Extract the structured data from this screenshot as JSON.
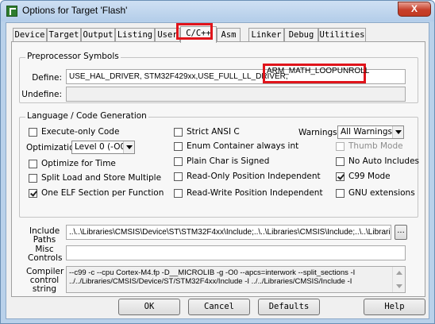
{
  "window": {
    "title": "Options for Target 'Flash'",
    "close_glyph": "X"
  },
  "tabs": [
    {
      "label": "Device"
    },
    {
      "label": "Target"
    },
    {
      "label": "Output"
    },
    {
      "label": "Listing"
    },
    {
      "label": "User"
    },
    {
      "label": "C/C++",
      "active": true
    },
    {
      "label": "Asm"
    },
    {
      "label": "Linker"
    },
    {
      "label": "Debug"
    },
    {
      "label": "Utilities"
    }
  ],
  "preprocessor": {
    "group_label": "Preprocessor Symbols",
    "define_label": "Define:",
    "define_value": "USE_HAL_DRIVER, STM32F429xx,USE_FULL_LL_DRIVER,",
    "define_highlighted": "ARM_MATH_LOOPUNROLL",
    "undefine_label": "Undefine:",
    "undefine_value": ""
  },
  "language": {
    "group_label": "Language / Code Generation",
    "optimization_label": "Optimization:",
    "optimization_value": "Level 0 (-O0)",
    "warnings_label": "Warnings:",
    "warnings_value": "All Warnings",
    "checks": {
      "execute_only": {
        "label": "Execute-only Code",
        "checked": false
      },
      "optimize_time": {
        "label": "Optimize for Time",
        "checked": false
      },
      "split_load": {
        "label": "Split Load and Store Multiple",
        "checked": false
      },
      "one_elf": {
        "label": "One ELF Section per Function",
        "checked": true
      },
      "strict_ansi": {
        "label": "Strict ANSI C",
        "checked": false
      },
      "enum_container": {
        "label": "Enum Container always int",
        "checked": false
      },
      "plain_char": {
        "label": "Plain Char is Signed",
        "checked": false
      },
      "ro_pos": {
        "label": "Read-Only Position Independent",
        "checked": false
      },
      "rw_pos": {
        "label": "Read-Write Position Independent",
        "checked": false
      },
      "thumb_mode": {
        "label": "Thumb Mode",
        "checked": false,
        "disabled": true
      },
      "no_auto_includes": {
        "label": "No Auto Includes",
        "checked": false
      },
      "c99_mode": {
        "label": "C99 Mode",
        "checked": true
      },
      "gnu_ext": {
        "label": "GNU extensions",
        "checked": false
      }
    }
  },
  "include": {
    "label_line1": "Include",
    "label_line2": "Paths",
    "value": "..\\..\\Libraries\\CMSIS\\Device\\ST\\STM32F4xx\\Include;..\\..\\Libraries\\CMSIS\\Include;..\\..\\Libraries\\S",
    "browse_label": "..."
  },
  "misc": {
    "label_line1": "Misc",
    "label_line2": "Controls",
    "value": ""
  },
  "compiler": {
    "label_line1": "Compiler",
    "label_line2": "control",
    "label_line3": "string",
    "line1": "--c99 -c --cpu Cortex-M4.fp -D__MICROLIB -g -O0 --apcs=interwork --split_sections -I",
    "line2": "../../Libraries/CMSIS/Device/ST/STM32F4xx/Include -I ../../Libraries/CMSIS/Include -I"
  },
  "buttons": {
    "ok": "OK",
    "cancel": "Cancel",
    "defaults": "Defaults",
    "help": "Help"
  },
  "colors": {
    "highlight": "#e0141b",
    "window_frame": "#b9d1ea",
    "dialog_bg": "#f0f0f0"
  }
}
